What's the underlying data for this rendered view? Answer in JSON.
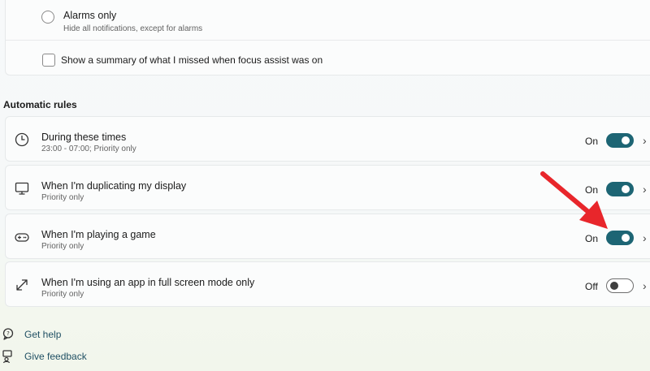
{
  "focus_options": {
    "alarms_only": {
      "title": "Alarms only",
      "subtitle": "Hide all notifications, except for alarms",
      "selected": false
    },
    "summary_checkbox": {
      "label": "Show a summary of what I missed when focus assist was on",
      "checked": false
    }
  },
  "automatic_rules": {
    "heading": "Automatic rules",
    "rules": [
      {
        "icon": "clock-icon",
        "title": "During these times",
        "subtitle": "23:00 - 07:00; Priority only",
        "state_label": "On",
        "enabled": true
      },
      {
        "icon": "monitor-icon",
        "title": "When I'm duplicating my display",
        "subtitle": "Priority only",
        "state_label": "On",
        "enabled": true
      },
      {
        "icon": "gamepad-icon",
        "title": "When I'm playing a game",
        "subtitle": "Priority only",
        "state_label": "On",
        "enabled": true
      },
      {
        "icon": "fullscreen-expand-icon",
        "title": "When I'm using an app in full screen mode only",
        "subtitle": "Priority only",
        "state_label": "Off",
        "enabled": false
      }
    ]
  },
  "footer": {
    "get_help": "Get help",
    "give_feedback": "Give feedback"
  },
  "colors": {
    "accent": "#1d6574",
    "annotation_arrow": "#e8262b",
    "link": "#1f4f63"
  }
}
